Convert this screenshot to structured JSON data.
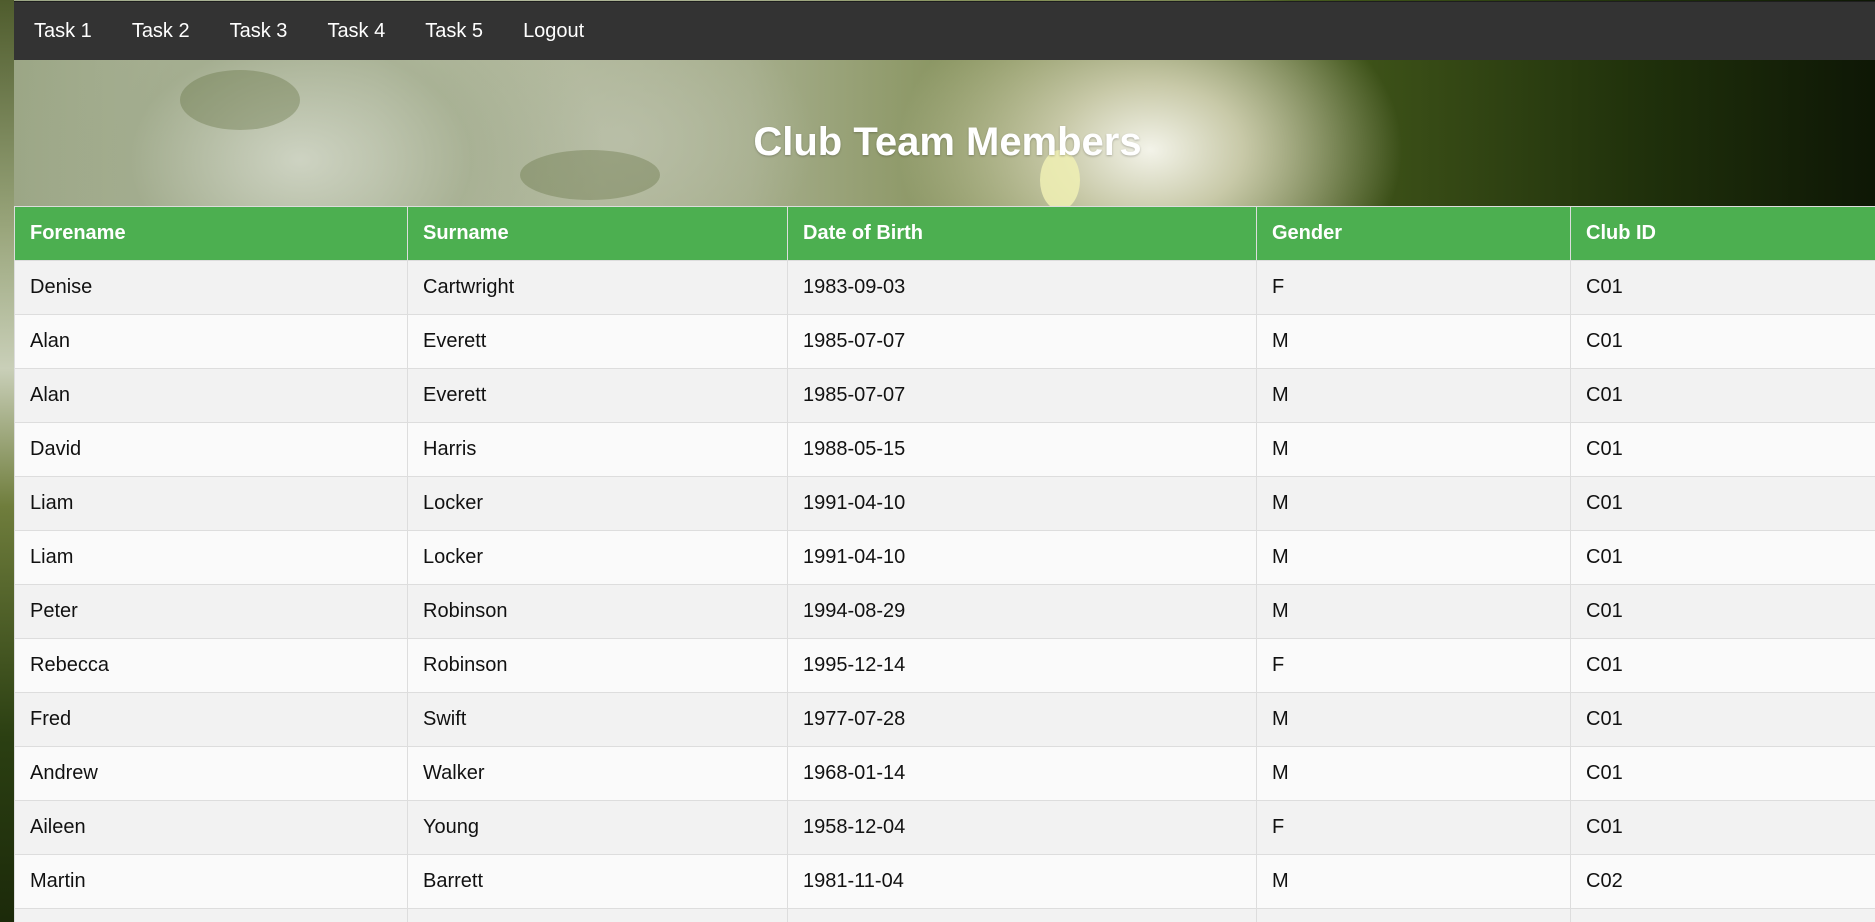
{
  "nav": {
    "items": [
      {
        "label": "Task 1"
      },
      {
        "label": "Task 2"
      },
      {
        "label": "Task 3"
      },
      {
        "label": "Task 4"
      },
      {
        "label": "Task 5"
      },
      {
        "label": "Logout"
      }
    ]
  },
  "page": {
    "title": "Club Team Members"
  },
  "table": {
    "header_color": "#4CAF50",
    "columns": [
      "Forename",
      "Surname",
      "Date of Birth",
      "Gender",
      "Club ID"
    ],
    "rows": [
      [
        "Denise",
        "Cartwright",
        "1983-09-03",
        "F",
        "C01"
      ],
      [
        "Alan",
        "Everett",
        "1985-07-07",
        "M",
        "C01"
      ],
      [
        "Alan",
        "Everett",
        "1985-07-07",
        "M",
        "C01"
      ],
      [
        "David",
        "Harris",
        "1988-05-15",
        "M",
        "C01"
      ],
      [
        "Liam",
        "Locker",
        "1991-04-10",
        "M",
        "C01"
      ],
      [
        "Liam",
        "Locker",
        "1991-04-10",
        "M",
        "C01"
      ],
      [
        "Peter",
        "Robinson",
        "1994-08-29",
        "M",
        "C01"
      ],
      [
        "Rebecca",
        "Robinson",
        "1995-12-14",
        "F",
        "C01"
      ],
      [
        "Fred",
        "Swift",
        "1977-07-28",
        "M",
        "C01"
      ],
      [
        "Andrew",
        "Walker",
        "1968-01-14",
        "M",
        "C01"
      ],
      [
        "Aileen",
        "Young",
        "1958-12-04",
        "F",
        "C01"
      ],
      [
        "Martin",
        "Barrett",
        "1981-11-04",
        "M",
        "C02"
      ],
      [
        "",
        "",
        "",
        "",
        ""
      ]
    ]
  }
}
